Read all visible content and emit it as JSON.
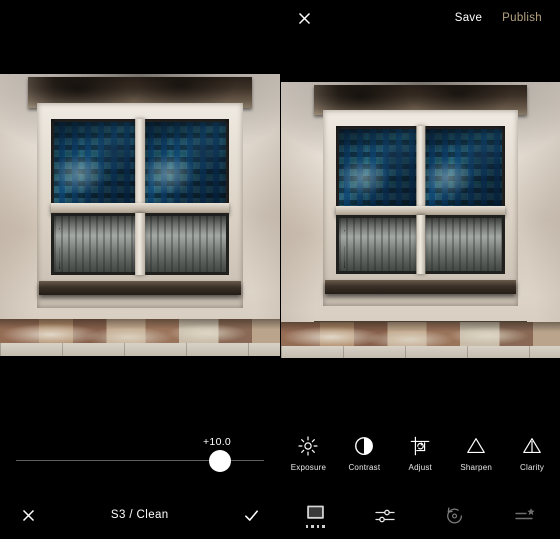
{
  "left_panel": {
    "slider": {
      "value_label": "+10.0",
      "knob_position_pct": 78
    },
    "preset_label": "S3 / Clean",
    "cancel_icon": "close-x-icon",
    "confirm_icon": "checkmark-icon"
  },
  "right_panel": {
    "topbar": {
      "close_icon": "close-x-icon",
      "save_label": "Save",
      "publish_label": "Publish",
      "publish_color": "#b5a382"
    },
    "tools": [
      {
        "label": "Exposure",
        "icon": "sun-brightness-icon"
      },
      {
        "label": "Contrast",
        "icon": "half-circle-contrast-icon"
      },
      {
        "label": "Adjust",
        "icon": "crop-rotate-icon"
      },
      {
        "label": "Sharpen",
        "icon": "triangle-outline-icon"
      },
      {
        "label": "Clarity",
        "icon": "triangle-split-icon"
      }
    ],
    "nav": [
      {
        "icon": "presets-thumbnail-icon",
        "active": true
      },
      {
        "icon": "sliders-adjust-icon",
        "active": false
      },
      {
        "icon": "undo-history-icon",
        "active": false
      },
      {
        "icon": "list-star-icon",
        "active": false
      }
    ]
  },
  "photo": {
    "subject": "weathered building window with blue reflective panes",
    "frame_color": "#e0d7ca",
    "glass_color": "#1d4a5e"
  }
}
